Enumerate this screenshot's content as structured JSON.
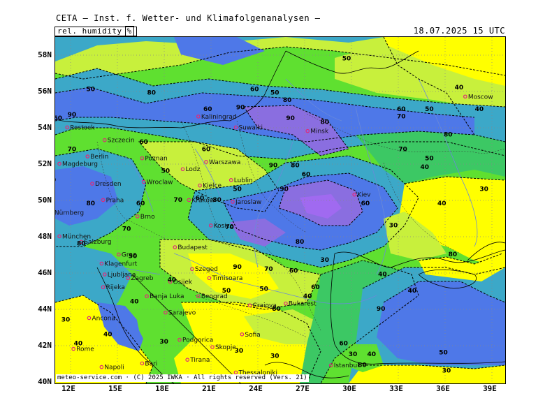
{
  "header": {
    "title": "CETA — Inst. f. Wetter- und Klimafolgenanalysen —",
    "field": "rel. humidity",
    "unit": "%",
    "timestamp": "18.07.2025 15 UTC"
  },
  "footer": {
    "credit": "meteo-service.com · (C) 2025 IWKA · All rights reserved (Vers. 21)"
  },
  "axes": {
    "lat_labels": [
      "58N",
      "56N",
      "54N",
      "52N",
      "50N",
      "48N",
      "46N",
      "44N",
      "42N",
      "40N"
    ],
    "lon_labels": [
      "12E",
      "15E",
      "18E",
      "21E",
      "24E",
      "27E",
      "30E",
      "33E",
      "36E",
      "39E"
    ]
  },
  "colors": {
    "p30": "#ffff00",
    "p40": "#c8f03c",
    "p50": "#5fe030",
    "p60": "#3cc864",
    "p70": "#3ca8c8",
    "p80": "#4e78e8",
    "p90": "#8a6ee0",
    "p95": "#a06af0",
    "contour": "#000000",
    "rivers": "#6a8ad8",
    "city_dot": "#e0287a"
  },
  "cities": [
    {
      "name": "Moscow",
      "lon": 37.6,
      "lat": 55.8
    },
    {
      "name": "Minsk",
      "lon": 27.5,
      "lat": 53.9
    },
    {
      "name": "Kaliningrad",
      "lon": 20.5,
      "lat": 54.7
    },
    {
      "name": "Suwalki",
      "lon": 22.9,
      "lat": 54.1
    },
    {
      "name": "Rostock",
      "lon": 12.1,
      "lat": 54.1
    },
    {
      "name": "Szczecin",
      "lon": 14.5,
      "lat": 53.4
    },
    {
      "name": "Berlin",
      "lon": 13.4,
      "lat": 52.5
    },
    {
      "name": "Magdeburg",
      "lon": 11.6,
      "lat": 52.1
    },
    {
      "name": "Poznan",
      "lon": 16.9,
      "lat": 52.4
    },
    {
      "name": "Warszawa",
      "lon": 21.0,
      "lat": 52.2
    },
    {
      "name": "Lodz",
      "lon": 19.5,
      "lat": 51.8
    },
    {
      "name": "Lublin",
      "lon": 22.6,
      "lat": 51.2
    },
    {
      "name": "Dresden",
      "lon": 13.7,
      "lat": 51.0
    },
    {
      "name": "Wroclaw",
      "lon": 17.0,
      "lat": 51.1
    },
    {
      "name": "Kielce",
      "lon": 20.6,
      "lat": 50.9
    },
    {
      "name": "Kraków",
      "lon": 19.9,
      "lat": 50.1
    },
    {
      "name": "Jaroslaw",
      "lon": 22.7,
      "lat": 50.0
    },
    {
      "name": "Praha",
      "lon": 14.4,
      "lat": 50.1
    },
    {
      "name": "Brno",
      "lon": 16.6,
      "lat": 49.2
    },
    {
      "name": "Kosice",
      "lon": 21.3,
      "lat": 48.7
    },
    {
      "name": "Nürnberg",
      "lon": 11.1,
      "lat": 49.4
    },
    {
      "name": "München",
      "lon": 11.6,
      "lat": 48.1
    },
    {
      "name": "Salzburg",
      "lon": 13.0,
      "lat": 47.8
    },
    {
      "name": "Graz",
      "lon": 15.4,
      "lat": 47.1
    },
    {
      "name": "Budapest",
      "lon": 19.0,
      "lat": 47.5
    },
    {
      "name": "Szeged",
      "lon": 20.1,
      "lat": 46.3
    },
    {
      "name": "Klagenfurt",
      "lon": 14.3,
      "lat": 46.6
    },
    {
      "name": "Ljubljana",
      "lon": 14.5,
      "lat": 46.0
    },
    {
      "name": "Zagreb",
      "lon": 16.0,
      "lat": 45.8
    },
    {
      "name": "Osijek",
      "lon": 18.7,
      "lat": 45.6
    },
    {
      "name": "Rijeka",
      "lon": 14.4,
      "lat": 45.3
    },
    {
      "name": "Timisoara",
      "lon": 21.2,
      "lat": 45.8
    },
    {
      "name": "Beograd",
      "lon": 20.5,
      "lat": 44.8
    },
    {
      "name": "Banja Luka",
      "lon": 17.2,
      "lat": 44.8
    },
    {
      "name": "Bukarest",
      "lon": 26.1,
      "lat": 44.4
    },
    {
      "name": "Craiova",
      "lon": 23.8,
      "lat": 44.3
    },
    {
      "name": "Sarajevo",
      "lon": 18.4,
      "lat": 43.9
    },
    {
      "name": "Ancona",
      "lon": 13.5,
      "lat": 43.6
    },
    {
      "name": "Sofia",
      "lon": 23.3,
      "lat": 42.7
    },
    {
      "name": "Podgorica",
      "lon": 19.3,
      "lat": 42.4
    },
    {
      "name": "Skopje",
      "lon": 21.4,
      "lat": 42.0
    },
    {
      "name": "Rome",
      "lon": 12.5,
      "lat": 41.9
    },
    {
      "name": "Tirana",
      "lon": 19.8,
      "lat": 41.3
    },
    {
      "name": "Thessaloniki",
      "lon": 22.9,
      "lat": 40.6
    },
    {
      "name": "Napoli",
      "lon": 14.3,
      "lat": 40.9
    },
    {
      "name": "Bari",
      "lon": 16.9,
      "lat": 41.1
    },
    {
      "name": "Istanbul",
      "lon": 29.0,
      "lat": 41.0
    },
    {
      "name": "Kiev",
      "lon": 30.5,
      "lat": 50.4
    }
  ],
  "contour_labels": [
    {
      "v": "50",
      "lon": 30.0,
      "lat": 57.8
    },
    {
      "v": "40",
      "lon": 37.2,
      "lat": 56.2
    },
    {
      "v": "80",
      "lon": 17.5,
      "lat": 55.9
    },
    {
      "v": "50",
      "lon": 13.6,
      "lat": 56.1
    },
    {
      "v": "60",
      "lon": 24.1,
      "lat": 56.1
    },
    {
      "v": "50",
      "lon": 25.4,
      "lat": 55.9
    },
    {
      "v": "80",
      "lon": 26.2,
      "lat": 55.5
    },
    {
      "v": "60",
      "lon": 21.1,
      "lat": 55.0
    },
    {
      "v": "90",
      "lon": 23.2,
      "lat": 55.1
    },
    {
      "v": "90",
      "lon": 26.4,
      "lat": 54.5
    },
    {
      "v": "80",
      "lon": 28.6,
      "lat": 54.3
    },
    {
      "v": "60",
      "lon": 33.5,
      "lat": 55.0
    },
    {
      "v": "70",
      "lon": 33.5,
      "lat": 54.6
    },
    {
      "v": "50",
      "lon": 35.3,
      "lat": 55.0
    },
    {
      "v": "80",
      "lon": 36.5,
      "lat": 53.6
    },
    {
      "v": "70",
      "lon": 33.6,
      "lat": 52.8
    },
    {
      "v": "50",
      "lon": 35.3,
      "lat": 52.3
    },
    {
      "v": "40",
      "lon": 35.0,
      "lat": 51.8
    },
    {
      "v": "60",
      "lon": 17.0,
      "lat": 53.2
    },
    {
      "v": "60",
      "lon": 21.0,
      "lat": 52.8
    },
    {
      "v": "70",
      "lon": 12.4,
      "lat": 52.8
    },
    {
      "v": "90",
      "lon": 25.3,
      "lat": 51.9
    },
    {
      "v": "80",
      "lon": 26.7,
      "lat": 51.9
    },
    {
      "v": "60",
      "lon": 27.4,
      "lat": 51.4
    },
    {
      "v": "50",
      "lon": 18.4,
      "lat": 51.6
    },
    {
      "v": "90",
      "lon": 26.0,
      "lat": 50.6
    },
    {
      "v": "50",
      "lon": 23.0,
      "lat": 50.6
    },
    {
      "v": "60",
      "lon": 20.6,
      "lat": 50.1
    },
    {
      "v": "80",
      "lon": 21.7,
      "lat": 50.0
    },
    {
      "v": "70",
      "lon": 19.2,
      "lat": 50.0
    },
    {
      "v": "60",
      "lon": 16.8,
      "lat": 49.8
    },
    {
      "v": "80",
      "lon": 13.6,
      "lat": 49.8
    },
    {
      "v": "60",
      "lon": 31.2,
      "lat": 49.8
    },
    {
      "v": "40",
      "lon": 36.1,
      "lat": 49.8
    },
    {
      "v": "30",
      "lon": 38.8,
      "lat": 50.6
    },
    {
      "v": "30",
      "lon": 33.0,
      "lat": 48.6
    },
    {
      "v": "70",
      "lon": 22.5,
      "lat": 48.5
    },
    {
      "v": "70",
      "lon": 15.9,
      "lat": 48.4
    },
    {
      "v": "80",
      "lon": 27.0,
      "lat": 47.7
    },
    {
      "v": "80",
      "lon": 13.0,
      "lat": 47.6
    },
    {
      "v": "50",
      "lon": 16.3,
      "lat": 46.9
    },
    {
      "v": "90",
      "lon": 23.0,
      "lat": 46.3
    },
    {
      "v": "70",
      "lon": 25.0,
      "lat": 46.2
    },
    {
      "v": "60",
      "lon": 26.6,
      "lat": 46.1
    },
    {
      "v": "30",
      "lon": 28.6,
      "lat": 46.7
    },
    {
      "v": "40",
      "lon": 32.3,
      "lat": 45.9
    },
    {
      "v": "80",
      "lon": 36.8,
      "lat": 47.0
    },
    {
      "v": "40",
      "lon": 18.8,
      "lat": 45.6
    },
    {
      "v": "50",
      "lon": 24.7,
      "lat": 45.1
    },
    {
      "v": "50",
      "lon": 22.3,
      "lat": 45.0
    },
    {
      "v": "40",
      "lon": 16.4,
      "lat": 44.4
    },
    {
      "v": "40",
      "lon": 27.5,
      "lat": 44.7
    },
    {
      "v": "90",
      "lon": 32.2,
      "lat": 44.0
    },
    {
      "v": "40",
      "lon": 34.2,
      "lat": 45.0
    },
    {
      "v": "40",
      "lon": 14.7,
      "lat": 42.6
    },
    {
      "v": "30",
      "lon": 18.3,
      "lat": 42.2
    },
    {
      "v": "30",
      "lon": 12.0,
      "lat": 43.4
    },
    {
      "v": "40",
      "lon": 12.8,
      "lat": 42.1
    },
    {
      "v": "30",
      "lon": 23.1,
      "lat": 41.7
    },
    {
      "v": "30",
      "lon": 25.4,
      "lat": 41.4
    },
    {
      "v": "30",
      "lon": 30.4,
      "lat": 41.5
    },
    {
      "v": "80",
      "lon": 31.0,
      "lat": 40.9
    },
    {
      "v": "40",
      "lon": 31.6,
      "lat": 41.5
    },
    {
      "v": "50",
      "lon": 36.2,
      "lat": 41.6
    },
    {
      "v": "30",
      "lon": 36.4,
      "lat": 40.6
    },
    {
      "v": "80",
      "lon": 11.1,
      "lat": 51.1
    },
    {
      "v": "60",
      "lon": 11.5,
      "lat": 54.5
    },
    {
      "v": "90",
      "lon": 12.4,
      "lat": 54.7
    },
    {
      "v": "80",
      "lon": 25.5,
      "lat": 44.0
    },
    {
      "v": "60",
      "lon": 28.0,
      "lat": 45.2
    },
    {
      "v": "60",
      "lon": 29.8,
      "lat": 42.1
    },
    {
      "v": "40",
      "lon": 38.5,
      "lat": 55.0
    }
  ]
}
